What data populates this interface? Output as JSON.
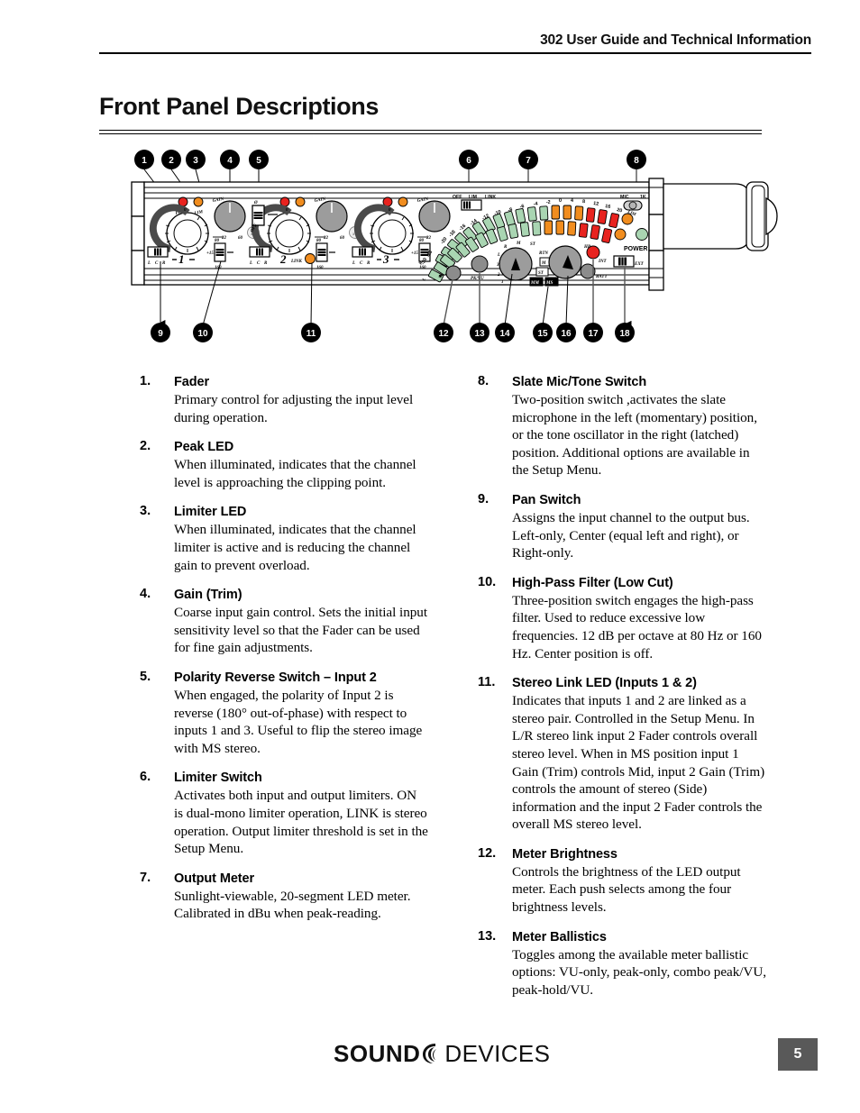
{
  "header": {
    "title": "302 User Guide and Technical Information"
  },
  "page_title": "Front Panel Descriptions",
  "figure": {
    "alt": "302 front panel diagram with numbered callouts",
    "callouts_top": [
      "1",
      "2",
      "3",
      "4",
      "5",
      "6",
      "7",
      "8"
    ],
    "callouts_bottom": [
      "9",
      "10",
      "11",
      "12",
      "13",
      "14",
      "15",
      "16",
      "17",
      "18"
    ],
    "panel_labels": {
      "pk": "PK",
      "lim": "LIM",
      "gain": "GAIN",
      "zero": "0",
      "gain_22": "22",
      "gain_60": "60",
      "polarity": "Ø",
      "off": "OFF",
      "hpf_80": "80",
      "hpf_160": "160",
      "pan_l": "L",
      "pan_c": "C",
      "pan_r": "R",
      "fader_plus15": "+15",
      "channel_1": "1",
      "channel_2": "2",
      "channel_3": "3",
      "link": "LINK",
      "lim_sw_off": "OFF",
      "lim_sw_lim": "LIM",
      "lim_sw_link": "LINK",
      "mic": "MIC",
      "tone_1k": "1K",
      "meter_lim": "LIM",
      "power": "POWER",
      "power_int": "INT",
      "power_ext": "EXT",
      "batt": "BATT",
      "hp": "HP",
      "brightness": "*",
      "pk_vu": "PK/VU",
      "monitor_L": "L",
      "monitor_R": "R",
      "monitor_M": "M",
      "monitor_ST": "ST",
      "monitor_RTN": "RTN",
      "monitor_1": "1",
      "monitor_2": "2",
      "monitor_3": "3",
      "sel_M": "M",
      "sel_ST": "ST",
      "sel_MM": "MM",
      "sel_MS": "MS",
      "meter_left": "L",
      "meter_right": "R"
    },
    "meter_scale": [
      "-30",
      "-28",
      "-20",
      "-18",
      "-16",
      "-14",
      "-12",
      "-10",
      "-8",
      "-6",
      "-4",
      "-2",
      "0",
      "4",
      "8",
      "12",
      "16",
      "20"
    ],
    "colors": {
      "green": "#a9d5b2",
      "orange": "#f18d1f",
      "red": "#e8231f",
      "knob_gray": "#9c9c9c",
      "panel_white": "#ffffff",
      "callout_black": "#000000"
    }
  },
  "items_left": [
    {
      "num": "1.",
      "title": "Fader",
      "body": "Primary control for adjusting the input level during operation."
    },
    {
      "num": "2.",
      "title": "Peak LED",
      "body": "When illuminated, indicates that the channel level is approaching the clipping point."
    },
    {
      "num": "3.",
      "title": "Limiter LED",
      "body": "When illuminated, indicates that the channel limiter is active and is reducing the channel gain to prevent overload."
    },
    {
      "num": "4.",
      "title": "Gain (Trim)",
      "body": "Coarse input gain control. Sets the initial input sensitivity level so that the Fader can be used for fine gain adjustments."
    },
    {
      "num": "5.",
      "title": "Polarity Reverse Switch – Input 2",
      "body": "When engaged, the polarity of Input 2 is reverse (180° out-of-phase) with respect to inputs 1 and 3. Useful to flip the stereo image with MS stereo."
    },
    {
      "num": "6.",
      "title": "Limiter Switch",
      "body": "Activates both input and output limiters. ON is dual-mono limiter operation, LINK is stereo operation. Output limiter threshold is set in the Setup Menu."
    },
    {
      "num": "7.",
      "title": "Output Meter",
      "body": "Sunlight-viewable, 20-segment LED meter. Calibrated in dBu when peak-reading."
    }
  ],
  "items_right": [
    {
      "num": "8.",
      "title": "Slate Mic/Tone Switch",
      "body": "Two-position switch ,activates the slate microphone in the left (momentary) position, or the tone oscillator in the right (latched) position. Additional options are available in the Setup Menu."
    },
    {
      "num": "9.",
      "title": "Pan Switch",
      "body": "Assigns the input channel to the output bus. Left-only, Center (equal left and right), or Right-only."
    },
    {
      "num": "10.",
      "title": "High-Pass Filter (Low Cut)",
      "body": "Three-position switch engages the high-pass filter. Used to reduce excessive low frequencies. 12 dB per octave at 80 Hz or 160 Hz. Center position is off."
    },
    {
      "num": "11.",
      "title": "Stereo Link LED (Inputs 1 & 2)",
      "body": "Indicates that inputs 1 and 2 are linked as a stereo pair. Controlled in the Setup Menu. In L/R stereo link input 2 Fader controls overall stereo level. When in MS position input 1 Gain (Trim) controls Mid, input 2 Gain (Trim) controls the amount of stereo (Side) information and the input 2 Fader controls the overall MS stereo level."
    },
    {
      "num": "12.",
      "title": "Meter Brightness",
      "body": "Controls the brightness of the LED output meter. Each push selects among the four brightness levels."
    },
    {
      "num": "13.",
      "title": "Meter Ballistics",
      "body": "Toggles among the available meter ballistic options: VU-only, peak-only, combo peak/VU, peak-hold/VU."
    }
  ],
  "footer": {
    "logo_sound": "SOUND",
    "logo_devices": "DEVICES",
    "page_number": "5"
  }
}
